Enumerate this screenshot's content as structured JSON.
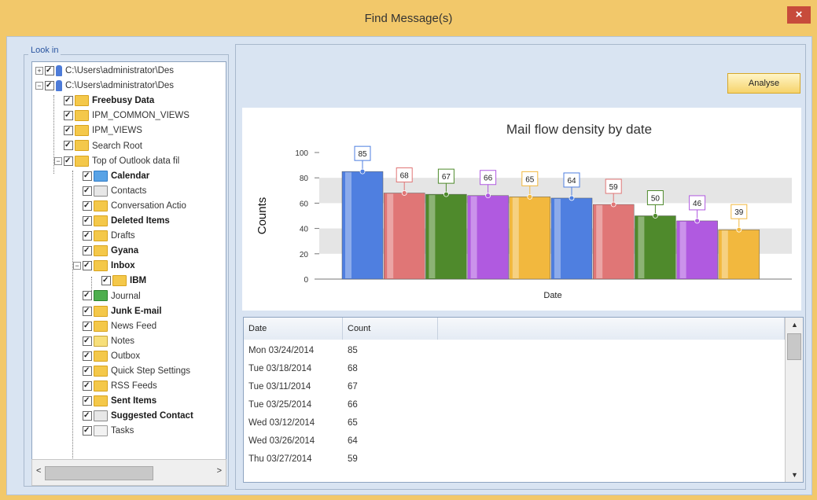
{
  "window": {
    "title": "Find Message(s)",
    "close_label": "×"
  },
  "lookin": {
    "label": "Look in"
  },
  "tree": {
    "items": [
      {
        "label": "C:\\Users\\administrator\\Des",
        "bold": false,
        "icon": "pst-icon",
        "expander": "+"
      },
      {
        "label": "C:\\Users\\administrator\\Des",
        "bold": false,
        "icon": "pst-icon",
        "expander": "−"
      },
      {
        "label": "Freebusy Data",
        "bold": true,
        "icon": "folder-icon"
      },
      {
        "label": "IPM_COMMON_VIEWS",
        "bold": false,
        "icon": "folder-icon"
      },
      {
        "label": "IPM_VIEWS",
        "bold": false,
        "icon": "folder-icon"
      },
      {
        "label": "Search Root",
        "bold": false,
        "icon": "folder-icon"
      },
      {
        "label": "Top of Outlook data fil",
        "bold": false,
        "icon": "folder-icon",
        "expander": "−"
      },
      {
        "label": "Calendar",
        "bold": true,
        "icon": "calendar-icon"
      },
      {
        "label": "Contacts",
        "bold": false,
        "icon": "contacts-icon"
      },
      {
        "label": "Conversation Actio",
        "bold": false,
        "icon": "folder-icon"
      },
      {
        "label": "Deleted Items",
        "bold": true,
        "icon": "folder-icon"
      },
      {
        "label": "Drafts",
        "bold": false,
        "icon": "folder-icon"
      },
      {
        "label": "Gyana",
        "bold": true,
        "icon": "folder-icon"
      },
      {
        "label": "Inbox",
        "bold": true,
        "icon": "folder-icon",
        "expander": "−"
      },
      {
        "label": "IBM",
        "bold": true,
        "icon": "folder-icon"
      },
      {
        "label": "Journal",
        "bold": false,
        "icon": "journal-icon"
      },
      {
        "label": "Junk E-mail",
        "bold": true,
        "icon": "folder-icon"
      },
      {
        "label": "News Feed",
        "bold": false,
        "icon": "folder-icon"
      },
      {
        "label": "Notes",
        "bold": false,
        "icon": "notes-icon"
      },
      {
        "label": "Outbox",
        "bold": false,
        "icon": "folder-icon"
      },
      {
        "label": "Quick Step Settings",
        "bold": false,
        "icon": "folder-icon"
      },
      {
        "label": "RSS Feeds",
        "bold": false,
        "icon": "folder-icon"
      },
      {
        "label": "Sent Items",
        "bold": true,
        "icon": "folder-icon"
      },
      {
        "label": "Suggested Contact",
        "bold": true,
        "icon": "contacts-icon"
      },
      {
        "label": "Tasks",
        "bold": false,
        "icon": "tasks-icon"
      }
    ]
  },
  "scroll": {
    "left": "<",
    "right": ">",
    "up": "▲",
    "down": "▼"
  },
  "analyse_button": {
    "label": "Analyse"
  },
  "chart_data": {
    "type": "bar",
    "title": "Mail flow density by date",
    "xlabel": "Date",
    "ylabel": "Counts",
    "ylim": [
      0,
      100
    ],
    "yticks": [
      0,
      20,
      40,
      60,
      80,
      100
    ],
    "values": [
      85,
      68,
      67,
      66,
      65,
      64,
      59,
      50,
      46,
      39
    ],
    "colors": [
      "#4f7fe0",
      "#e07676",
      "#4f8a2c",
      "#b05ae0",
      "#f2b83e",
      "#4f7fe0",
      "#e07676",
      "#4f8a2c",
      "#b05ae0",
      "#f2b83e"
    ],
    "legend": "none",
    "grid": "alternating bands"
  },
  "table": {
    "headers": [
      "Date",
      "Count"
    ],
    "rows": [
      [
        "Mon 03/24/2014",
        "85"
      ],
      [
        "Tue 03/18/2014",
        "68"
      ],
      [
        "Tue 03/11/2014",
        "67"
      ],
      [
        "Tue 03/25/2014",
        "66"
      ],
      [
        "Wed 03/12/2014",
        "65"
      ],
      [
        "Wed 03/26/2014",
        "64"
      ],
      [
        "Thu 03/27/2014",
        "59"
      ]
    ]
  }
}
